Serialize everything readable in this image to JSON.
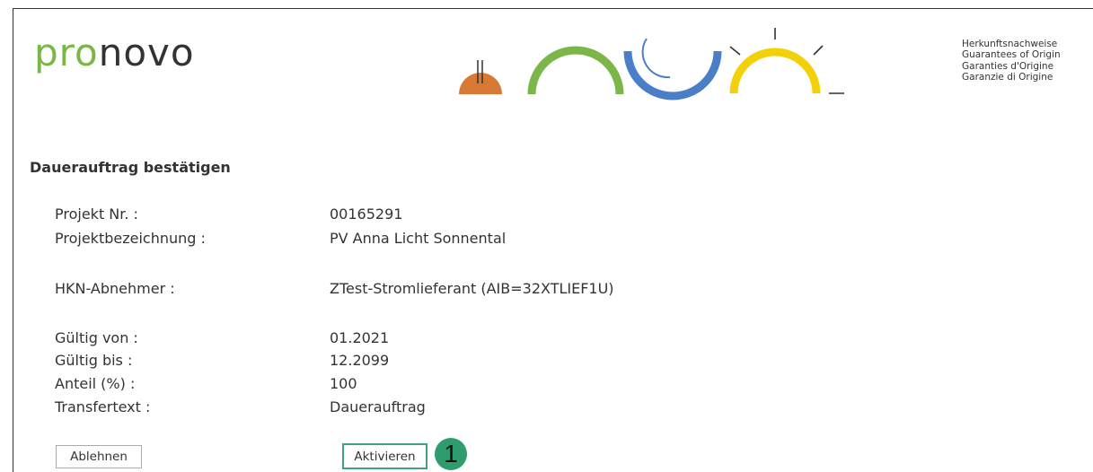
{
  "header": {
    "logo_part1": "pro",
    "logo_part2": "novo",
    "tagline": [
      "Herkunftsnachweise",
      "Guarantees of Origin",
      "Garanties d'Origine",
      "Garanzie di Origine"
    ]
  },
  "colors": {
    "brand_green": "#7ab648",
    "hydro_blue": "#4a7ec7",
    "solar_yellow": "#f2d10a",
    "biomass_orange": "#d87a35",
    "highlight_teal": "#2f9c6e"
  },
  "form": {
    "title": "Dauerauftrag bestätigen",
    "fields": {
      "projekt_nr": {
        "label": "Projekt Nr. :",
        "value": "00165291"
      },
      "projektbezeichnung": {
        "label": "Projektbezeichnung :",
        "value": "PV Anna Licht Sonnental"
      },
      "hkn_abnehmer": {
        "label": "HKN-Abnehmer :",
        "value": "ZTest-Stromlieferant (AIB=32XTLIEF1U)"
      },
      "gueltig_von": {
        "label": "Gültig von :",
        "value": "01.2021"
      },
      "gueltig_bis": {
        "label": "Gültig bis :",
        "value": "12.2099"
      },
      "anteil": {
        "label": "Anteil (%) :",
        "value": "100"
      },
      "transfertext": {
        "label": "Transfertext :",
        "value": "Dauerauftrag"
      }
    },
    "buttons": {
      "reject": "Ablehnen",
      "activate": "Aktivieren"
    }
  },
  "annotation": {
    "step_number": "1"
  }
}
